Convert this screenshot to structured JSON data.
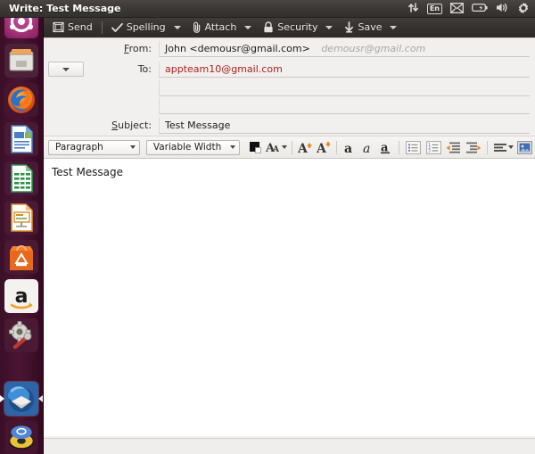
{
  "window": {
    "title": "Write: Test Message"
  },
  "tray": {
    "items": [
      {
        "name": "network-updown-icon",
        "label": ""
      },
      {
        "name": "keyboard-layout-indicator",
        "label": "En"
      },
      {
        "name": "mail-envelope-icon",
        "label": ""
      },
      {
        "name": "battery-icon",
        "label": ""
      },
      {
        "name": "volume-speaker-icon",
        "label": ""
      },
      {
        "name": "system-gear-icon",
        "label": ""
      }
    ]
  },
  "launcher": {
    "items": [
      {
        "name": "ubuntu-dash-icon",
        "label": "Ubuntu Dash"
      },
      {
        "name": "files-icon",
        "label": "Files"
      },
      {
        "name": "firefox-icon",
        "label": "Firefox"
      },
      {
        "name": "libreoffice-writer-icon",
        "label": "LibreOffice Writer"
      },
      {
        "name": "libreoffice-calc-icon",
        "label": "LibreOffice Calc"
      },
      {
        "name": "libreoffice-impress-icon",
        "label": "LibreOffice Impress"
      },
      {
        "name": "ubuntu-software-center-icon",
        "label": "Ubuntu Software Center"
      },
      {
        "name": "amazon-icon",
        "label": "Amazon"
      },
      {
        "name": "system-settings-icon",
        "label": "System Settings"
      },
      {
        "name": "thunderbird-icon",
        "label": "Thunderbird"
      },
      {
        "name": "media-disc-icon",
        "label": "Media"
      }
    ]
  },
  "toolbar": {
    "send_label": "Send",
    "spelling_label": "Spelling",
    "attach_label": "Attach",
    "security_label": "Security",
    "save_label": "Save"
  },
  "headers": {
    "from_label": "From:",
    "from_value": "John <demousr@gmail.com>",
    "from_account": "demousr@gmail.com",
    "to_label": "To:",
    "to_value": "appteam10@gmail.com",
    "subject_label": "Subject:",
    "subject_value": "Test Message"
  },
  "formatbar": {
    "paragraph_value": "Paragraph",
    "font_value": "Variable Width",
    "buttons": [
      {
        "name": "text-color-swatch",
        "label": "Text Color"
      },
      {
        "name": "font-size-icon",
        "label": "Font Size"
      },
      {
        "name": "increase-font-size-icon",
        "label": "Increase Font Size"
      },
      {
        "name": "decrease-font-size-icon",
        "label": "Decrease Font Size"
      },
      {
        "name": "bold-icon",
        "label": "Bold"
      },
      {
        "name": "italic-icon",
        "label": "Italic"
      },
      {
        "name": "underline-icon",
        "label": "Underline"
      },
      {
        "name": "bullet-list-icon",
        "label": "Bullet List"
      },
      {
        "name": "numbered-list-icon",
        "label": "Numbered List"
      },
      {
        "name": "outdent-icon",
        "label": "Decrease Indent"
      },
      {
        "name": "indent-icon",
        "label": "Increase Indent"
      },
      {
        "name": "align-icon",
        "label": "Align"
      },
      {
        "name": "insert-image-icon",
        "label": "Insert Image"
      }
    ]
  },
  "body": {
    "text": "Test Message"
  },
  "colors": {
    "titlebar": "#3b3734",
    "toolbar": "#36322f",
    "launcher": "#4a1534",
    "recipient_text": "#b02020",
    "chrome_light": "#f1f0ee"
  }
}
